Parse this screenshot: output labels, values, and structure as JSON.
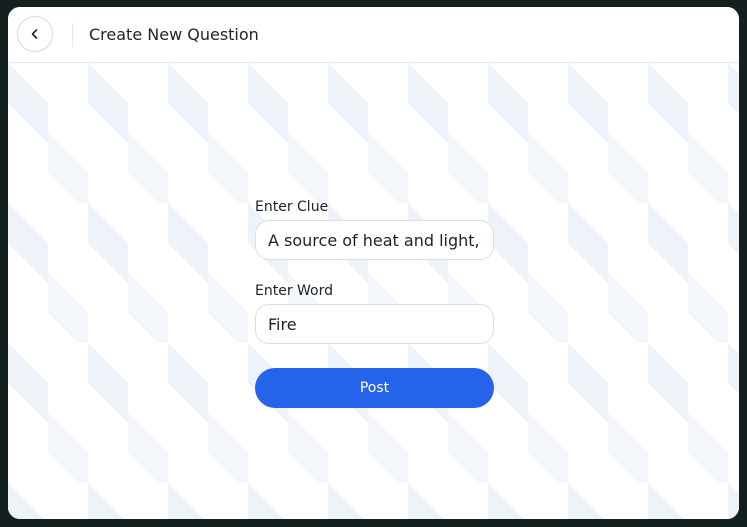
{
  "header": {
    "back_icon": "chevron-left-icon",
    "title": "Create New Question"
  },
  "form": {
    "clue_label": "Enter Clue",
    "clue_value": "A source of heat and light,",
    "word_label": "Enter Word",
    "word_value": "Fire",
    "post_label": "Post"
  },
  "colors": {
    "accent": "#2563eb",
    "pattern": "#eef2f9",
    "window_bg": "#ffffff",
    "outer_bg": "#14201f"
  }
}
